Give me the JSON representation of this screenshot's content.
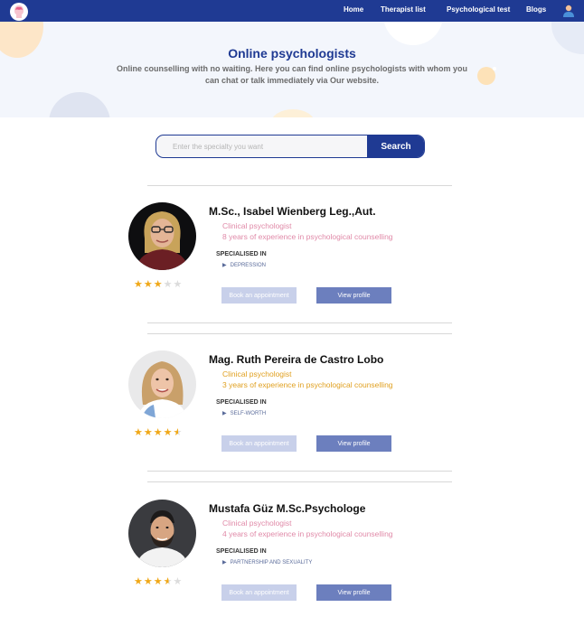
{
  "colors": {
    "brand": "#1f3a93",
    "star_filled": "#f0a818",
    "star_empty": "#dcdcdc",
    "role_pink": "#e08aa8",
    "role_gold": "#e0a020"
  },
  "nav": {
    "logo_icon": "brain-head-icon",
    "links": [
      "Home",
      "Therapist list",
      "Psychological test",
      "Blogs"
    ],
    "user_icon": "user-avatar-icon"
  },
  "hero": {
    "title": "Online psychologists",
    "subtitle": "Online counselling with no waiting. Here you can find online psychologists with whom you can chat or talk immediately via Our website."
  },
  "search": {
    "placeholder": "Enter the specialty you want",
    "button_label": "Search"
  },
  "psychologists": [
    {
      "name": "M.Sc., Isabel Wienberg Leg.,Aut.",
      "role": "Clinical psychologist",
      "experience": "8 years of experience in psychological counselling",
      "specialised_label": "SPECIALISED IN",
      "specialty": "DEPRESSION",
      "rating": 3,
      "text_color": "#e08aa8",
      "book_label": "Book an appointment",
      "view_label": "View profile"
    },
    {
      "name": "Mag. Ruth Pereira de Castro Lobo",
      "role": "Clinical psychologist",
      "experience": "3 years of experience in psychological counselling",
      "specialised_label": "SPECIALISED IN",
      "specialty": "SELF-WORTH",
      "rating": 4.5,
      "text_color": "#e0a020",
      "book_label": "Book an appointment",
      "view_label": "View profile"
    },
    {
      "name": "Mustafa Güz M.Sc.Psychologe",
      "role": "Clinical psychologist",
      "experience": "4 years of experience in psychological counselling",
      "specialised_label": "SPECIALISED IN",
      "specialty": "PARTNERSHIP AND SEXUALITY",
      "rating": 3.5,
      "text_color": "#e08aa8",
      "book_label": "Book an appointment",
      "view_label": "View profile"
    }
  ]
}
